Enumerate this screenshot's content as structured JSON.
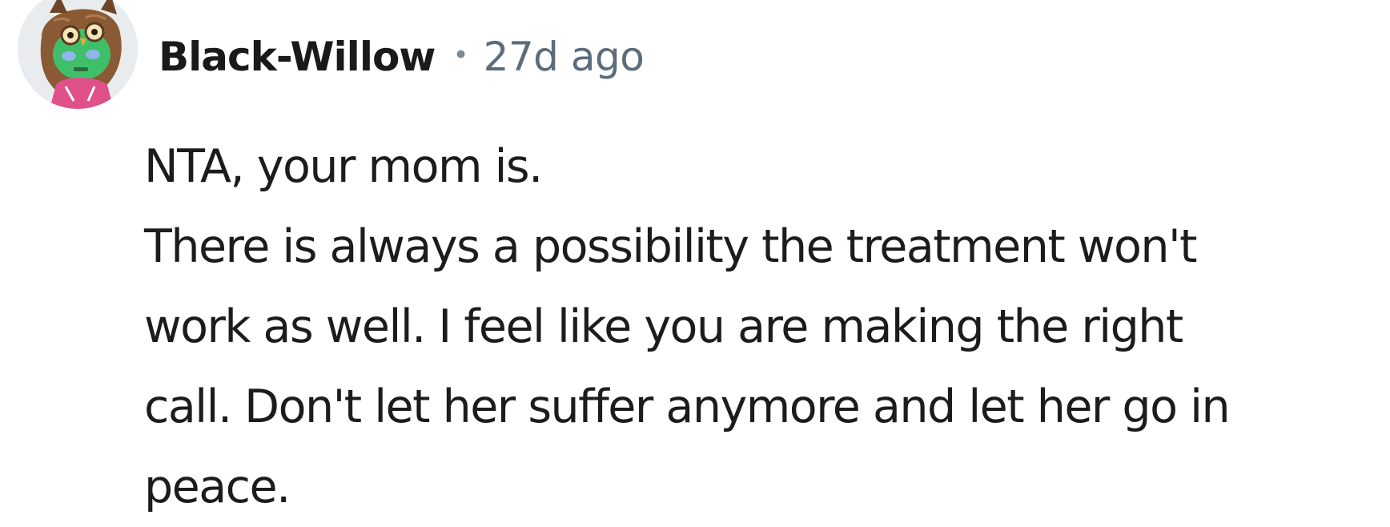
{
  "comment": {
    "author": "Black-Willow",
    "separator": "•",
    "timestamp": "27d ago",
    "avatar_icon": "snoo-avatar-icon",
    "body_lines": [
      "NTA, your mom is.",
      "There is always a possibility the treatment won't",
      "work as well. I feel like you are making the right",
      "call. Don't let her suffer anymore and let her go in",
      "peace."
    ]
  }
}
